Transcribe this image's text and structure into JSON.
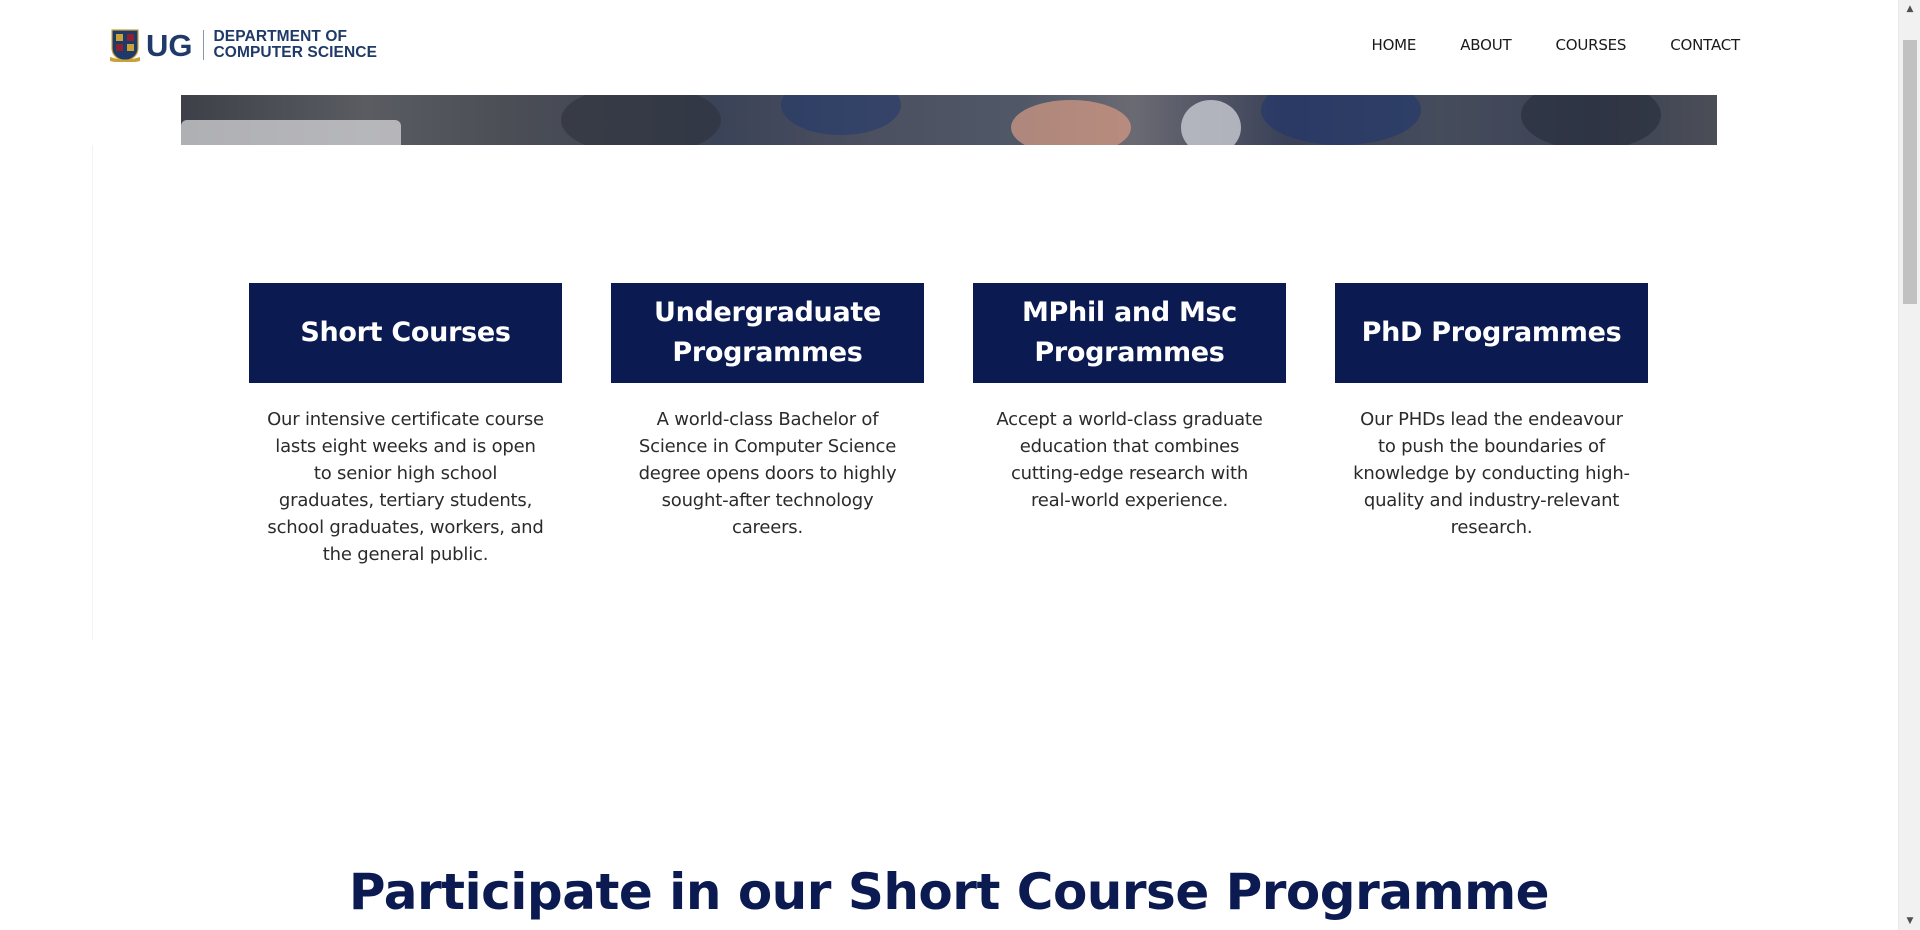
{
  "header": {
    "logo": {
      "ug": "UG",
      "dept_line1": "DEPARTMENT OF",
      "dept_line2": "COMPUTER SCIENCE"
    },
    "nav": [
      {
        "label": "HOME"
      },
      {
        "label": "ABOUT"
      },
      {
        "label": "COURSES"
      },
      {
        "label": "CONTACT"
      }
    ]
  },
  "cards": [
    {
      "title": "Short Courses",
      "description": "Our intensive certificate course lasts eight weeks and is open to senior high school graduates, tertiary students, school graduates, workers, and the general public."
    },
    {
      "title": "Undergraduate Programmes",
      "description": "A world-class Bachelor of Science in Computer Science degree opens doors to highly sought-after technology careers."
    },
    {
      "title": "MPhil and Msc Programmes",
      "description": "Accept a world-class graduate education that combines cutting-edge research with real-world experience."
    },
    {
      "title": "PhD Programmes",
      "description": "Our PHDs lead the endeavour to push the boundaries of knowledge by conducting high-quality and industry-relevant research."
    }
  ],
  "section": {
    "heading": "Participate in our Short Course Programme"
  },
  "colors": {
    "brand_navy": "#0b1b52",
    "logo_blue": "#1f3a68"
  },
  "icons": {
    "scroll_up": "triangle-up",
    "scroll_down": "triangle-down",
    "crest": "university-crest"
  }
}
